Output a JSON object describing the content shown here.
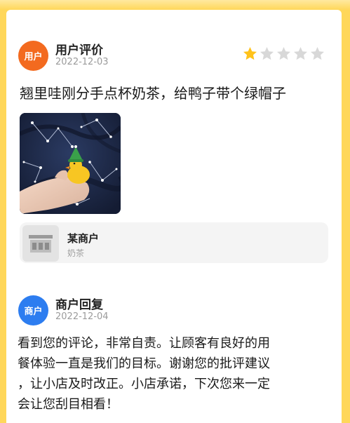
{
  "review": {
    "avatar_label": "用户",
    "name": "用户评价",
    "date": "2022-12-03",
    "rating": 1,
    "max_rating": 5,
    "text": "翘里哇刚分手点杯奶茶，给鸭子带个绿帽子"
  },
  "merchant": {
    "name": "某商户",
    "category": "奶茶"
  },
  "reply": {
    "avatar_label": "商户",
    "name": "商户回复",
    "date": "2022-12-04",
    "text": "看到您的评论，非常自责。让顾客有良好的用\n餐体验一直是我们的目标。谢谢您的批评建议\n，让小店及时改正。小店承诺，下次您来一定\n会让您刮目相看！"
  },
  "colors": {
    "star_filled": "#ffc21a",
    "star_empty": "#d8d8d8",
    "user_avatar": "#f36a1f",
    "shop_avatar": "#2d7df0",
    "frame": "#ffd75a"
  },
  "icons": {
    "rating": "star-icon",
    "shop": "storefront-icon"
  }
}
